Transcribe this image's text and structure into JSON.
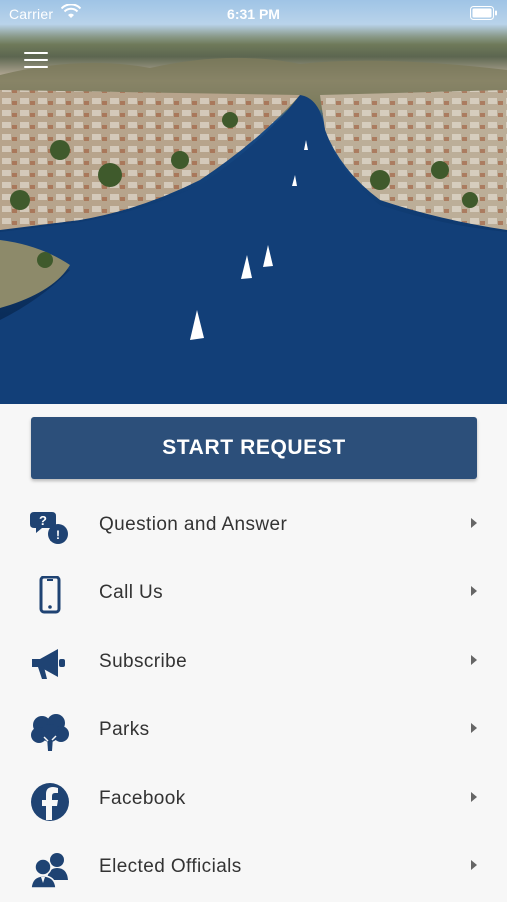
{
  "status_bar": {
    "carrier": "Carrier",
    "time": "6:31 PM"
  },
  "hero": {
    "image": "aerial-lake-with-sailboats"
  },
  "primary_action": {
    "label": "START REQUEST"
  },
  "menu": {
    "items": [
      {
        "label": "Question and Answer",
        "icon": "question-bubbles-icon"
      },
      {
        "label": "Call Us",
        "icon": "phone-icon"
      },
      {
        "label": "Subscribe",
        "icon": "megaphone-icon"
      },
      {
        "label": "Parks",
        "icon": "tree-icon"
      },
      {
        "label": "Facebook",
        "icon": "facebook-icon"
      },
      {
        "label": "Elected Officials",
        "icon": "officials-icon"
      }
    ]
  },
  "colors": {
    "accent": "#2c4f7a",
    "icon": "#1f4373",
    "text": "#333333",
    "background": "#f7f7f7"
  }
}
